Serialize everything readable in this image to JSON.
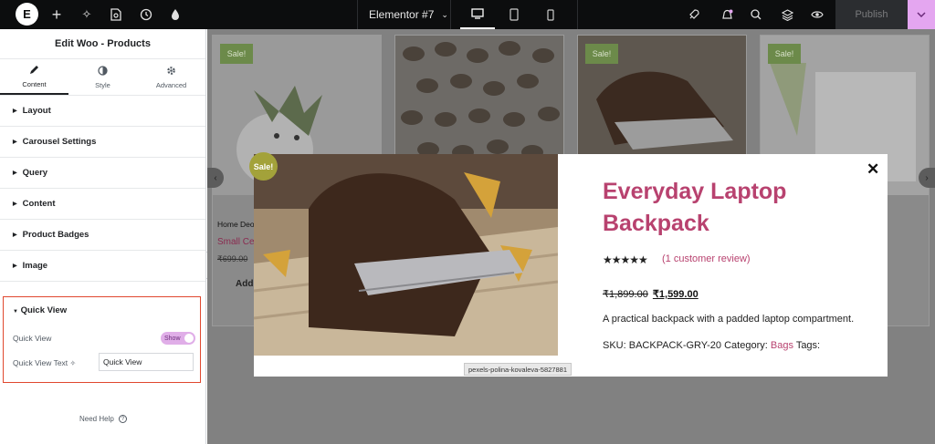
{
  "topbar": {
    "document_title": "Elementor #7",
    "publish_label": "Publish",
    "logo_letter": "E"
  },
  "panel": {
    "title": "Edit Woo - Products",
    "tabs": [
      {
        "label": "Content",
        "icon": "pencil-icon"
      },
      {
        "label": "Style",
        "icon": "half-circle-icon"
      },
      {
        "label": "Advanced",
        "icon": "gear-icon"
      }
    ],
    "sections": [
      "Layout",
      "Carousel Settings",
      "Query",
      "Content",
      "Product Badges",
      "Image"
    ],
    "quick_view": {
      "title": "Quick View",
      "toggle_label": "Quick View",
      "toggle_value": "Show",
      "text_label": "Quick View Text",
      "text_value": "Quick View"
    },
    "help": "Need Help"
  },
  "canvas": {
    "cards": [
      {
        "sale": "Sale!",
        "breadcrumb": "Home Deo",
        "name": "Small Ce",
        "price": "₹699.00",
        "button": "Add"
      },
      {
        "sale": "",
        "breadcrumb": "",
        "name": "",
        "price": "",
        "button": ""
      },
      {
        "sale": "Sale!",
        "breadcrumb": "",
        "name": "",
        "price": "",
        "button": ""
      },
      {
        "sale": "Sale!",
        "breadcrumb": "",
        "name": "",
        "price": "",
        "button": ""
      }
    ]
  },
  "modal": {
    "sale_badge": "Sale!",
    "close": "✕",
    "title": "Everyday Laptop Backpack",
    "rating": 5,
    "stars": "★★★★★",
    "review_link": "(1 customer review)",
    "old_price": "₹1,899.00",
    "new_price": "₹1,599.00",
    "description": "A practical backpack with a padded laptop compartment.",
    "sku_label": "SKU:",
    "sku": "BACKPACK-GRY-20",
    "category_label": "Category:",
    "category": "Bags",
    "tags_label": "Tags:",
    "image_tooltip": "pexels-polina-kovaleva-5827881"
  },
  "colors": {
    "accent": "#b8426f",
    "sale_badge": "#a3a23a",
    "highlight_border": "#e0482f",
    "toggle": "#e0aee8"
  }
}
